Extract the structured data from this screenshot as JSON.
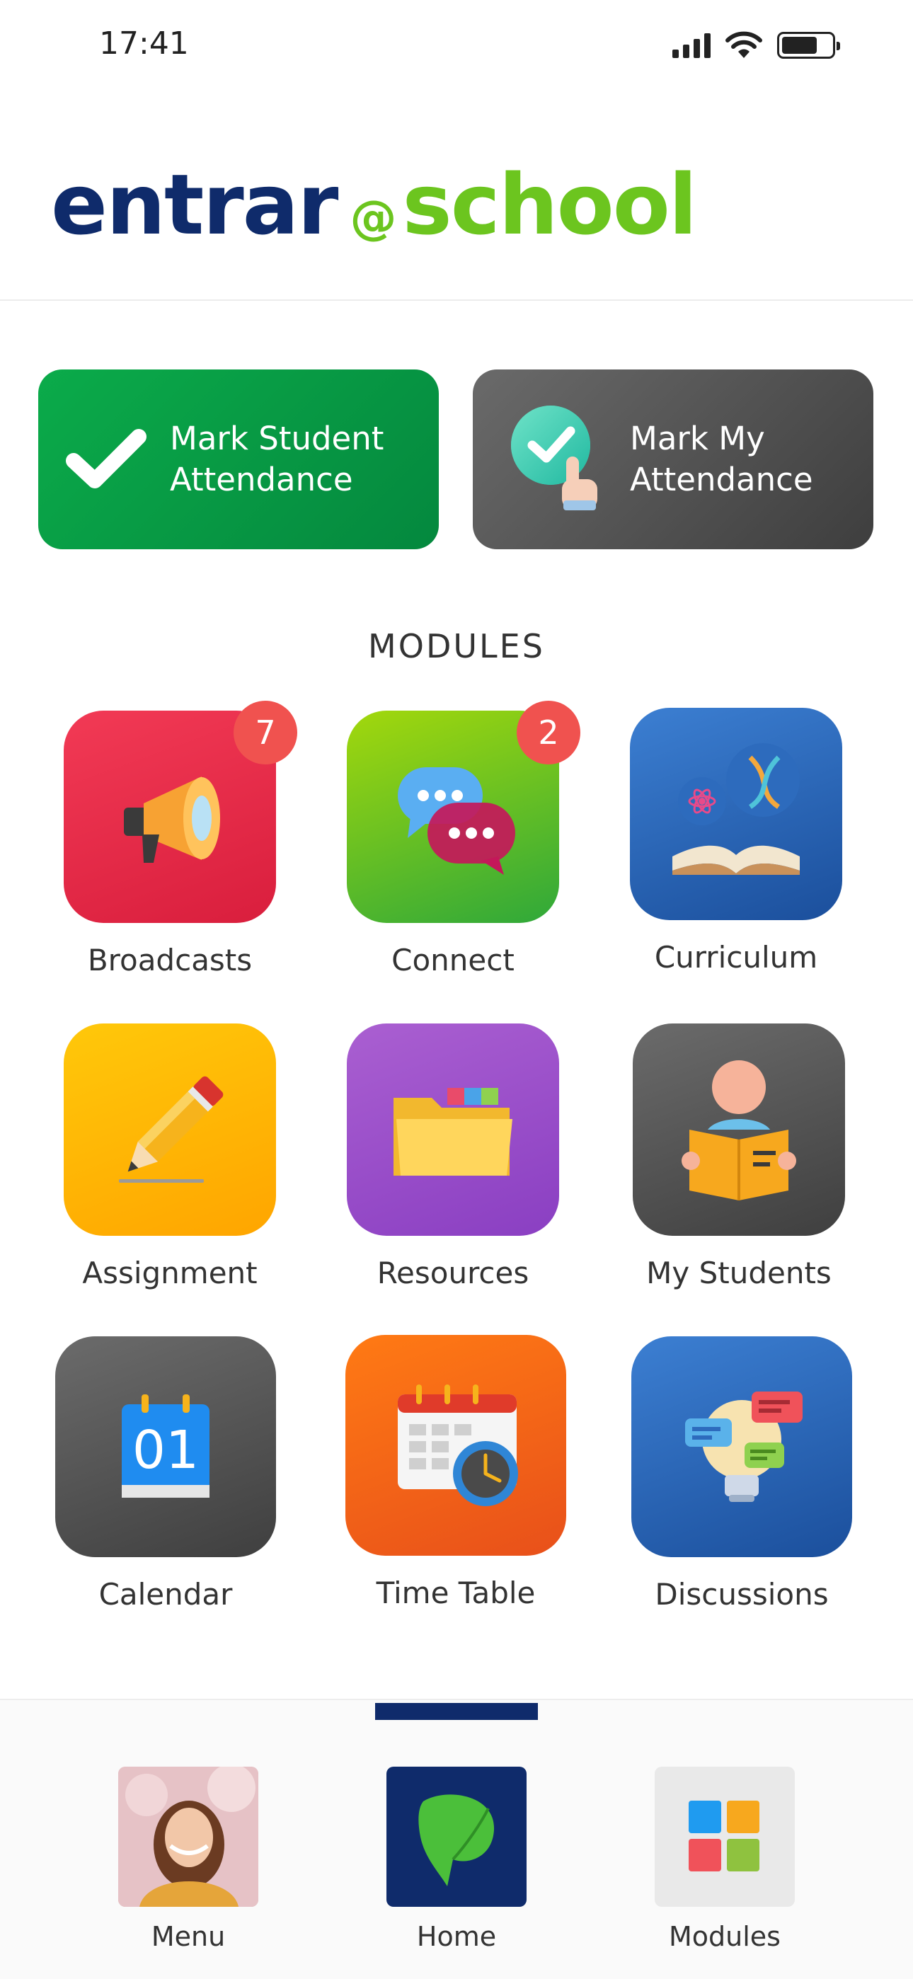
{
  "status_bar": {
    "time": "17:41"
  },
  "header": {
    "logo_part1": "entrar",
    "logo_at": "@",
    "logo_part2": "school"
  },
  "attendance": {
    "student_line1": "Mark Student",
    "student_line2": "Attendance",
    "mine_line1": "Mark My",
    "mine_line2": "Attendance"
  },
  "modules": {
    "heading": "MODULES",
    "items": [
      {
        "label": "Broadcasts",
        "badge": "7",
        "icon": "megaphone-icon"
      },
      {
        "label": "Connect",
        "badge": "2",
        "icon": "chat-bubbles-icon"
      },
      {
        "label": "Curriculum",
        "icon": "book-science-icon"
      },
      {
        "label": "Assignment",
        "icon": "pencil-icon"
      },
      {
        "label": "Resources",
        "icon": "folder-icon"
      },
      {
        "label": "My Students",
        "icon": "student-reading-icon"
      },
      {
        "label": "Calendar",
        "icon": "calendar-date-icon",
        "date": "01"
      },
      {
        "label": "Time Table",
        "icon": "timetable-clock-icon"
      },
      {
        "label": "Discussions",
        "icon": "lightbulb-chat-icon"
      }
    ]
  },
  "bottom_nav": {
    "items": [
      {
        "label": "Menu",
        "icon": "avatar"
      },
      {
        "label": "Home",
        "icon": "home-leaf-icon",
        "active": true
      },
      {
        "label": "Modules",
        "icon": "modules-grid-icon"
      }
    ]
  },
  "colors": {
    "brand_navy": "#0f2b6b",
    "brand_green": "#6cc51f",
    "attendance_green": "#0bab4a",
    "badge_red": "#f0524f"
  }
}
